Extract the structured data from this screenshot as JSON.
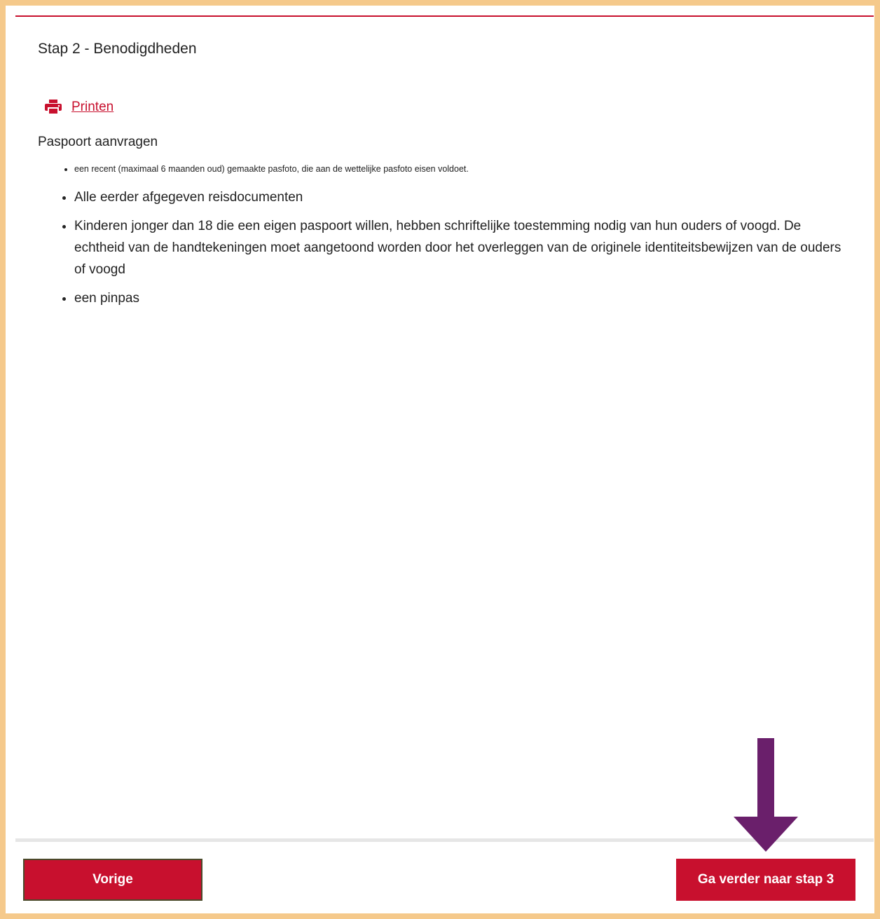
{
  "step": {
    "title": "Stap 2 - Benodigdheden"
  },
  "print": {
    "icon": "printer-icon",
    "label": "Printen"
  },
  "section": {
    "heading": "Paspoort aanvragen",
    "items": [
      "een recent (maximaal 6 maanden oud) gemaakte pasfoto, die aan de wettelijke pasfoto eisen voldoet.",
      "Alle eerder afgegeven reisdocumenten",
      "Kinderen jonger dan 18 die een eigen paspoort willen, hebben schriftelijke toestemming nodig van hun ouders of voogd. De echtheid van de handtekeningen moet aangetoond worden door het overleggen van de originele identiteitsbewijzen van de ouders of voogd",
      "een pinpas"
    ]
  },
  "footer": {
    "prev_label": "Vorige",
    "next_label": "Ga verder naar stap 3"
  },
  "colors": {
    "frame": "#f5c98b",
    "accent": "#c8102e",
    "annotation_arrow": "#6a1f6b"
  }
}
